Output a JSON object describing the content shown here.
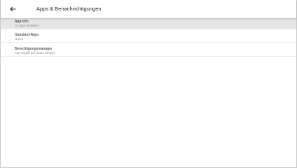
{
  "header": {
    "title": "Apps & Benachrichtigungen",
    "back_icon": "arrow-back-icon"
  },
  "settings": {
    "items": [
      {
        "title": "App-Info",
        "subtitle": "20 apps installiert",
        "active": true
      },
      {
        "title": "Standard-Apps",
        "subtitle": "Opera",
        "active": false
      },
      {
        "title": "Berechtigungsmanager",
        "subtitle": "App-Zugriff auf Daten steuern",
        "active": false
      }
    ]
  },
  "colors": {
    "active_row": "#e6e6e6",
    "primary_text": "#202124",
    "secondary_text": "#8a8a8a"
  }
}
